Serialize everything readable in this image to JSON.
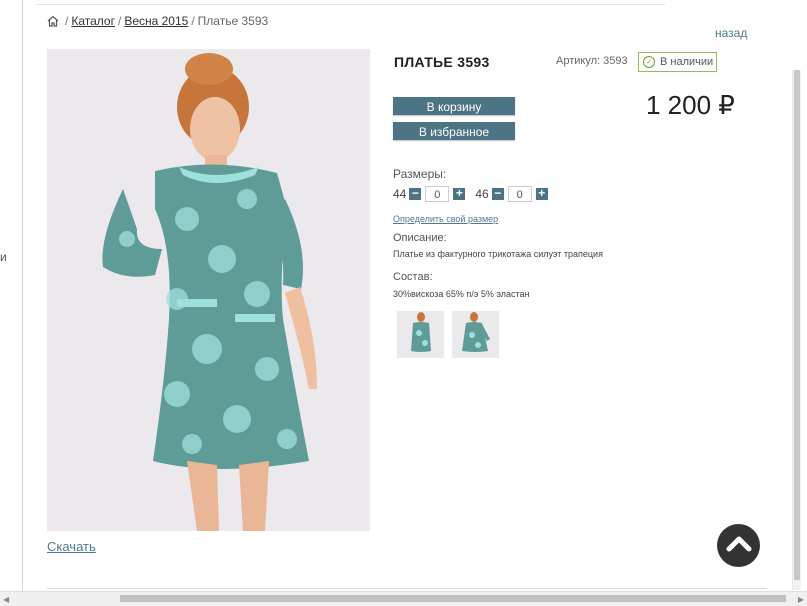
{
  "breadcrumb": {
    "home_icon": "home-icon",
    "separator": "/",
    "items": [
      "Каталог",
      "Весна 2015",
      "Платье 3593"
    ]
  },
  "edge_text": "и",
  "back_label": "назад",
  "product": {
    "title": "ПЛАТЬЕ 3593",
    "sku": "Артикул: 3593",
    "stock": "В наличии",
    "price": "1 200 ₽",
    "cart_label": "В корзину",
    "fav_label": "В избранное",
    "sizes_label": "Размеры:",
    "sizes": [
      {
        "size": "44",
        "qty": "0"
      },
      {
        "size": "46",
        "qty": "0"
      }
    ],
    "size_link": "Определить свой размер",
    "description_label": "Описание:",
    "description": "Платье из фактурного трикотажа силуэт трапеция",
    "composition_label": "Состав:",
    "composition": "30%вискоза 65% п/э 5% эластан",
    "download_label": "Скачать"
  },
  "colors": {
    "accent": "#4d7485",
    "link": "#4e7a8c",
    "dress": "#5f9c98",
    "dress_light": "#9ee0de",
    "stock_border": "#8fbf5a"
  }
}
